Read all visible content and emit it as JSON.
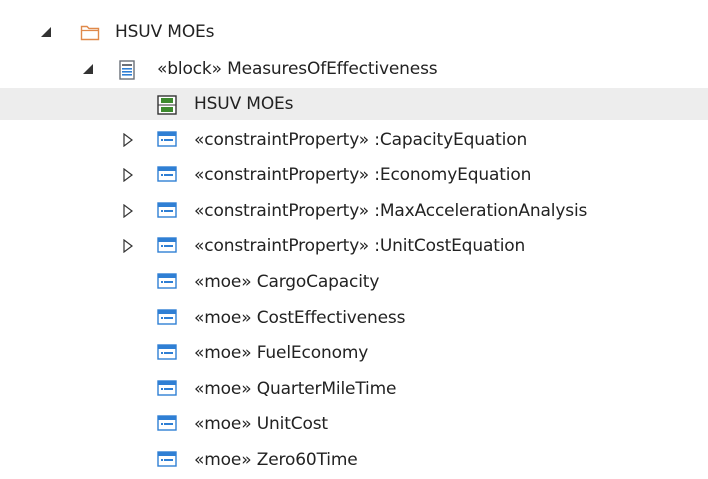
{
  "tree": {
    "root": {
      "label": "HSUV MOEs",
      "expanded": true,
      "icon": "folder-icon"
    },
    "block": {
      "label": "«block» MeasuresOfEffectiveness",
      "expanded": true,
      "icon": "block-icon"
    },
    "diagram": {
      "label": "HSUV MOEs",
      "icon": "diagram-icon",
      "selected": true
    },
    "items": [
      {
        "label": "«constraintProperty» :CapacityEquation",
        "expandable": true,
        "icon": "property-icon"
      },
      {
        "label": "«constraintProperty» :EconomyEquation",
        "expandable": true,
        "icon": "property-icon"
      },
      {
        "label": "«constraintProperty» :MaxAccelerationAnalysis",
        "expandable": true,
        "icon": "property-icon"
      },
      {
        "label": "«constraintProperty» :UnitCostEquation",
        "expandable": true,
        "icon": "property-icon"
      },
      {
        "label": "«moe» CargoCapacity",
        "expandable": false,
        "icon": "property-icon"
      },
      {
        "label": "«moe» CostEffectiveness",
        "expandable": false,
        "icon": "property-icon"
      },
      {
        "label": "«moe» FuelEconomy",
        "expandable": false,
        "icon": "property-icon"
      },
      {
        "label": "«moe» QuarterMileTime",
        "expandable": false,
        "icon": "property-icon"
      },
      {
        "label": "«moe» UnitCost",
        "expandable": false,
        "icon": "property-icon"
      },
      {
        "label": "«moe» Zero60Time",
        "expandable": false,
        "icon": "property-icon"
      }
    ]
  },
  "colors": {
    "selection": "#ededed",
    "text": "#222222",
    "property_icon_blue": "#2f7fd4",
    "diagram_icon_green": "#3d8a2e",
    "folder_stroke": "#e0894a"
  }
}
